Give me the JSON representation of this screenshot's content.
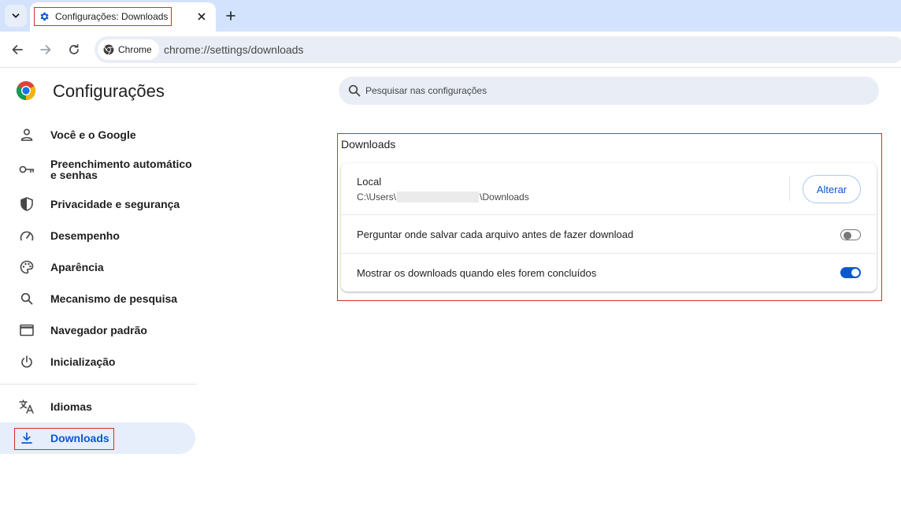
{
  "colors": {
    "accent": "#0b57d0",
    "tabstrip": "#d3e3fd",
    "highlight_border": "#d32f2f",
    "active_nav_bg": "#e6eefb"
  },
  "browser": {
    "tab": {
      "title": "Configurações: Downloads",
      "icon": "gear-icon"
    },
    "omnibox": {
      "chip_label": "Chrome",
      "url": "chrome://settings/downloads"
    }
  },
  "sidebar": {
    "title": "Configurações",
    "items": [
      {
        "label": "Você e o Google",
        "icon": "person-icon"
      },
      {
        "label": "Preenchimento automático e senhas",
        "icon": "key-icon"
      },
      {
        "label": "Privacidade e segurança",
        "icon": "shield-icon"
      },
      {
        "label": "Desempenho",
        "icon": "speedometer-icon"
      },
      {
        "label": "Aparência",
        "icon": "palette-icon"
      },
      {
        "label": "Mecanismo de pesquisa",
        "icon": "search-icon"
      },
      {
        "label": "Navegador padrão",
        "icon": "browser-window-icon"
      },
      {
        "label": "Inicialização",
        "icon": "power-icon"
      },
      {
        "label": "Idiomas",
        "icon": "translate-icon"
      },
      {
        "label": "Downloads",
        "icon": "download-icon",
        "active": true
      }
    ]
  },
  "search": {
    "placeholder": "Pesquisar nas configurações"
  },
  "downloads": {
    "section_title": "Downloads",
    "local_label": "Local",
    "path_prefix": "C:\\Users\\",
    "path_suffix": "\\Downloads",
    "change_button": "Alterar",
    "ask_where_label": "Perguntar onde salvar cada arquivo antes de fazer download",
    "ask_where_enabled": false,
    "show_when_done_label": "Mostrar os downloads quando eles forem concluídos",
    "show_when_done_enabled": true
  }
}
